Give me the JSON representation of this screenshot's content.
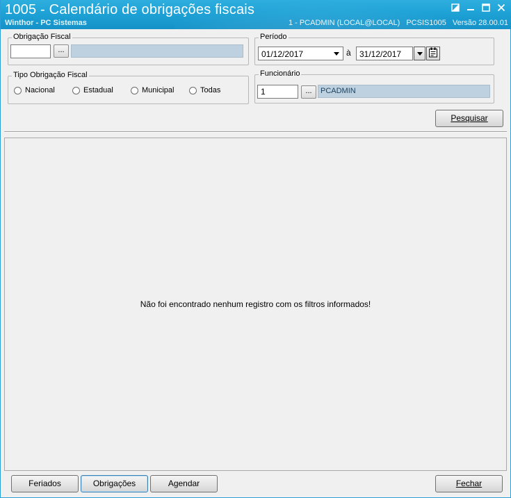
{
  "window": {
    "title": "1005 - Calendário de obrigações fiscais",
    "subtitle": "Winthor - PC Sistemas",
    "status": {
      "user": "1 - PCADMIN (LOCAL@LOCAL)",
      "program": "PCSIS1005",
      "version": "Versão  28.00.01"
    }
  },
  "obrigacao_fiscal": {
    "label": "Obrigação Fiscal",
    "code_value": "",
    "lookup_label": "...",
    "description": ""
  },
  "periodo": {
    "label": "Período",
    "start": "01/12/2017",
    "separator": "à",
    "end": "31/12/2017"
  },
  "tipo_obrigacao": {
    "label": "Tipo Obrigação Fiscal",
    "options": [
      "Nacional",
      "Estadual",
      "Municipal",
      "Todas"
    ]
  },
  "funcionario": {
    "label": "Funcionário",
    "code_value": "1",
    "lookup_label": "...",
    "description": "PCADMIN"
  },
  "buttons": {
    "pesquisar": "Pesquisar",
    "feriados": "Feriados",
    "obrigacoes": "Obrigações",
    "agendar": "Agendar",
    "fechar": "Fechar"
  },
  "results": {
    "empty_message": "Não foi encontrado nenhum registro com os filtros informados!"
  },
  "icons": {
    "minimize": "minimize-icon",
    "maximize": "maximize-icon",
    "close": "close-icon",
    "restore": "restore-icon",
    "calendar": "calendar-icon",
    "dropdown": "chevron-down-icon"
  },
  "colors": {
    "titlebar": "#1ea2d6",
    "readonly_field": "#bdd1e0"
  }
}
